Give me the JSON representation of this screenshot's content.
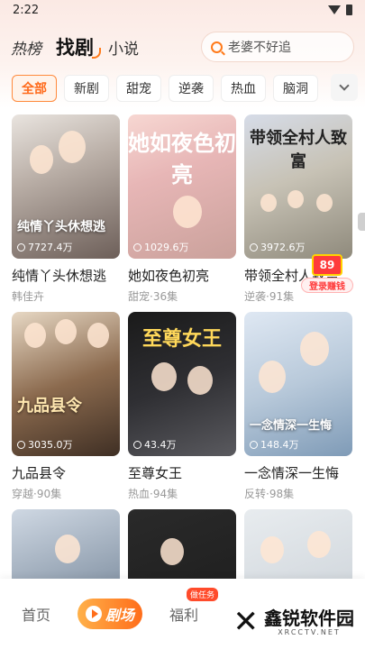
{
  "status": {
    "time": "2:22"
  },
  "header": {
    "tabs": [
      "热榜",
      "找剧",
      "小说"
    ],
    "active_tab": "找剧",
    "search_placeholder": "老婆不好追"
  },
  "genres": {
    "items": [
      "全部",
      "新剧",
      "甜宠",
      "逆袭",
      "热血",
      "脑洞"
    ],
    "active": "全部"
  },
  "dramas": [
    {
      "poster_title": "纯情丫头休想逃",
      "plays": "7727.4万",
      "title": "纯情丫头休想逃",
      "meta": "韩佳卉"
    },
    {
      "poster_title": "她如夜色初亮",
      "plays": "1029.6万",
      "title": "她如夜色初亮",
      "meta": "甜宠·36集"
    },
    {
      "poster_title": "带领全村人致富",
      "plays": "3972.6万",
      "title": "带领全村人致富",
      "meta": "逆袭·91集"
    },
    {
      "poster_title": "九品县令",
      "plays": "3035.0万",
      "title": "九品县令",
      "meta": "穿越·90集"
    },
    {
      "poster_title": "至尊女王",
      "plays": "43.4万",
      "title": "至尊女王",
      "meta": "热血·94集"
    },
    {
      "poster_title": "一念情深一生悔",
      "plays": "148.4万",
      "title": "一念情深一生悔",
      "meta": "反转·98集"
    },
    {
      "poster_title": "",
      "plays": "",
      "title": "",
      "meta": ""
    },
    {
      "poster_title": "",
      "plays": "",
      "title": "",
      "meta": ""
    },
    {
      "poster_title": "",
      "plays": "",
      "title": "",
      "meta": ""
    }
  ],
  "promo": {
    "value": "89",
    "label": "登录赚钱"
  },
  "bottom_nav": {
    "items": [
      "首页",
      "剧场",
      "福利"
    ],
    "active": "剧场",
    "badge": "做任务"
  },
  "watermark": {
    "brand": "鑫锐软件园",
    "url": "XRCCTV.NET"
  },
  "colors": {
    "accent": "#ff6d1a",
    "promo_red": "#ff3b3b"
  }
}
